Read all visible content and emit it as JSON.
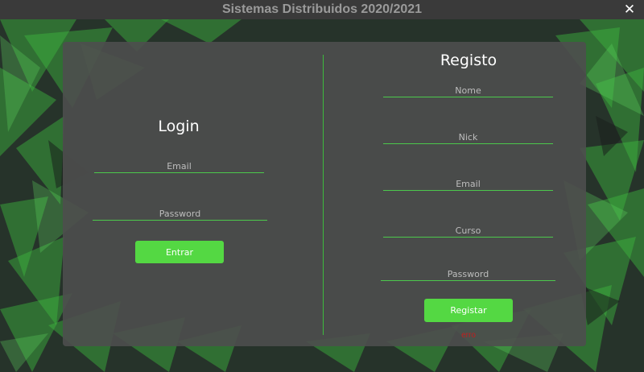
{
  "window": {
    "title": "Sistemas Distribuidos 2020/2021",
    "close_icon": "close-icon",
    "close_glyph": "✕"
  },
  "colors": {
    "accent": "#54d843",
    "underline": "#4cc84c",
    "panel": "#4e4e4e",
    "error": "#c21e1e"
  },
  "login": {
    "title": "Login",
    "email_placeholder": "Email",
    "password_placeholder": "Password",
    "submit_label": "Entrar"
  },
  "register": {
    "title": "Registo",
    "name_placeholder": "Nome",
    "nick_placeholder": "Nick",
    "email_placeholder": "Email",
    "course_placeholder": "Curso",
    "password_placeholder": "Password",
    "submit_label": "Registar",
    "error_text": "erro"
  }
}
